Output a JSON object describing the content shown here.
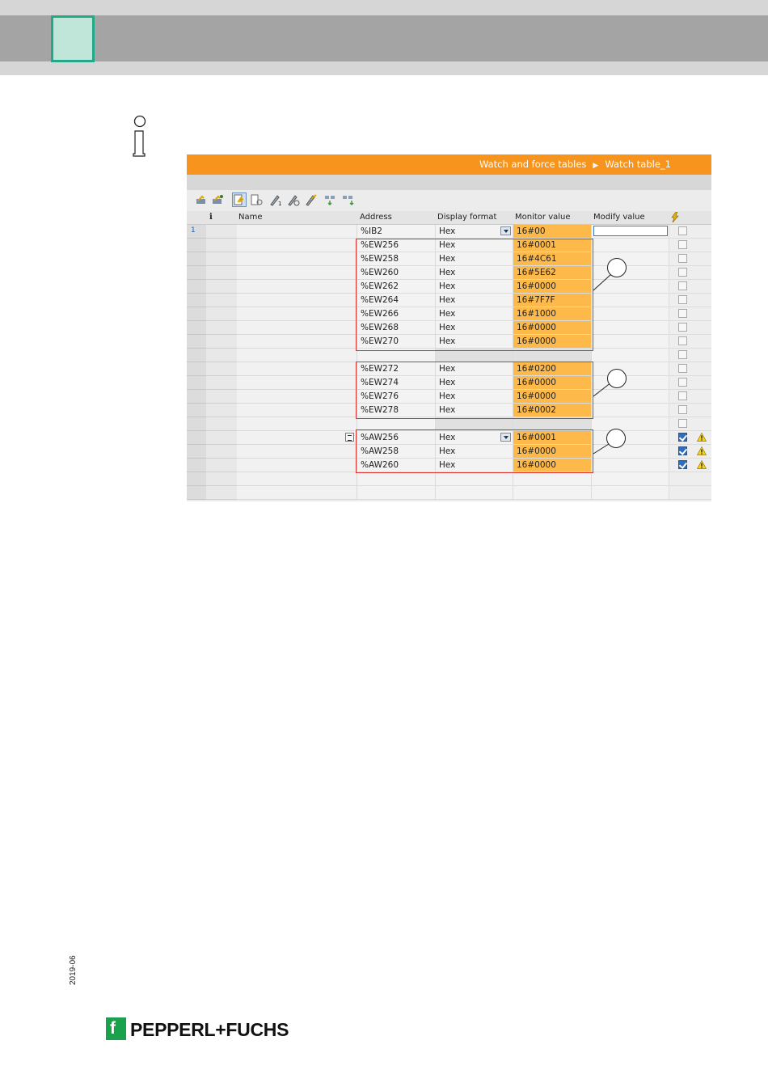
{
  "header": {
    "tab_color": "#23a88a"
  },
  "window": {
    "breadcrumb": [
      "Watch and force tables",
      "Watch table_1"
    ],
    "accent": "#f7941d"
  },
  "toolbar": {
    "icons": [
      "insert-row-icon",
      "add-row-icon",
      "monitor-all-icon",
      "monitor-once-icon",
      "modify-now-icon",
      "modify-trigger-icon",
      "enable-peripheral-icon",
      "show-hide-columns-icon",
      "expand-columns-icon"
    ]
  },
  "table": {
    "columns": {
      "info": "i",
      "name": "Name",
      "address": "Address",
      "display_format": "Display format",
      "monitor_value": "Monitor value",
      "modify_value": "Modify value",
      "force": ""
    },
    "rows": [
      {
        "num": "1",
        "address": "%IB2",
        "format": "Hex",
        "monitor": "16#00",
        "dropdown": true,
        "modify_active": true,
        "checked": false
      },
      {
        "num": "",
        "address": "%EW256",
        "format": "Hex",
        "monitor": "16#0001",
        "checked": false
      },
      {
        "num": "",
        "address": "%EW258",
        "format": "Hex",
        "monitor": "16#4C61",
        "checked": false
      },
      {
        "num": "",
        "address": "%EW260",
        "format": "Hex",
        "monitor": "16#5E62",
        "checked": false
      },
      {
        "num": "",
        "address": "%EW262",
        "format": "Hex",
        "monitor": "16#0000",
        "checked": false
      },
      {
        "num": "",
        "address": "%EW264",
        "format": "Hex",
        "monitor": "16#7F7F",
        "checked": false
      },
      {
        "num": "",
        "address": "%EW266",
        "format": "Hex",
        "monitor": "16#1000",
        "checked": false
      },
      {
        "num": "",
        "address": "%EW268",
        "format": "Hex",
        "monitor": "16#0000",
        "checked": false
      },
      {
        "num": "",
        "address": "%EW270",
        "format": "Hex",
        "monitor": "16#0000",
        "checked": false
      },
      {
        "num": "",
        "address": "",
        "format": "",
        "monitor": "",
        "checked": false,
        "gap": true
      },
      {
        "num": "",
        "address": "%EW272",
        "format": "Hex",
        "monitor": "16#0200",
        "checked": false
      },
      {
        "num": "",
        "address": "%EW274",
        "format": "Hex",
        "monitor": "16#0000",
        "checked": false
      },
      {
        "num": "",
        "address": "%EW276",
        "format": "Hex",
        "monitor": "16#0000",
        "checked": false
      },
      {
        "num": "",
        "address": "%EW278",
        "format": "Hex",
        "monitor": "16#0002",
        "checked": false
      },
      {
        "num": "",
        "address": "",
        "format": "",
        "monitor": "",
        "checked": false,
        "gap": true
      },
      {
        "num": "",
        "address": "%AW256",
        "format": "Hex",
        "monitor": "16#0001",
        "checked": true,
        "warn": true,
        "dropdown": true,
        "list_icon": true
      },
      {
        "num": "",
        "address": "%AW258",
        "format": "Hex",
        "monitor": "16#0000",
        "checked": true,
        "warn": true
      },
      {
        "num": "",
        "address": "%AW260",
        "format": "Hex",
        "monitor": "16#0000",
        "checked": true,
        "warn": true
      },
      {
        "num": "",
        "address": "",
        "format": "",
        "monitor": "",
        "empty": true
      },
      {
        "num": "",
        "address": "",
        "format": "",
        "monitor": "",
        "empty": true
      }
    ]
  },
  "footer": {
    "date": "2019-06",
    "logo_text": "PEPPERL+FUCHS",
    "logo_color": "#1aa14b"
  }
}
